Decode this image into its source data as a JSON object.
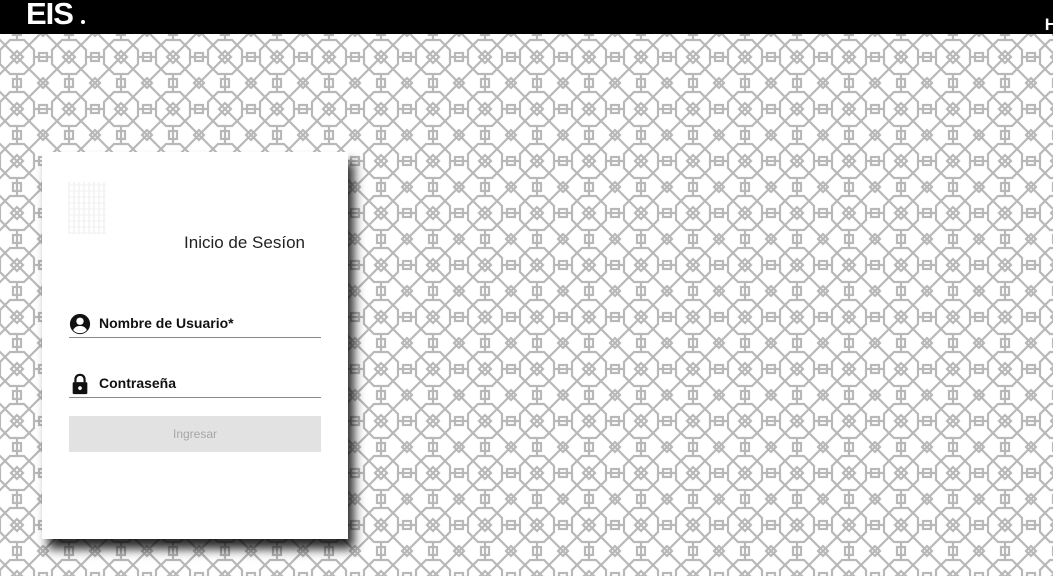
{
  "header": {
    "logo_text": "EIS",
    "right_text": "H"
  },
  "login": {
    "title": "Inicio de Sesíon",
    "username": {
      "label": "Nombre de Usuario*",
      "icon": "account-circle-icon",
      "value": ""
    },
    "password": {
      "label": "Contraseña",
      "icon": "lock-icon",
      "value": ""
    },
    "submit_label": "Ingresar",
    "submit_disabled": true
  },
  "colors": {
    "topbar": "#000000",
    "pattern_line": "#b8b8b8",
    "button_bg": "#e2e2e2",
    "button_text": "#a6a6a6"
  }
}
